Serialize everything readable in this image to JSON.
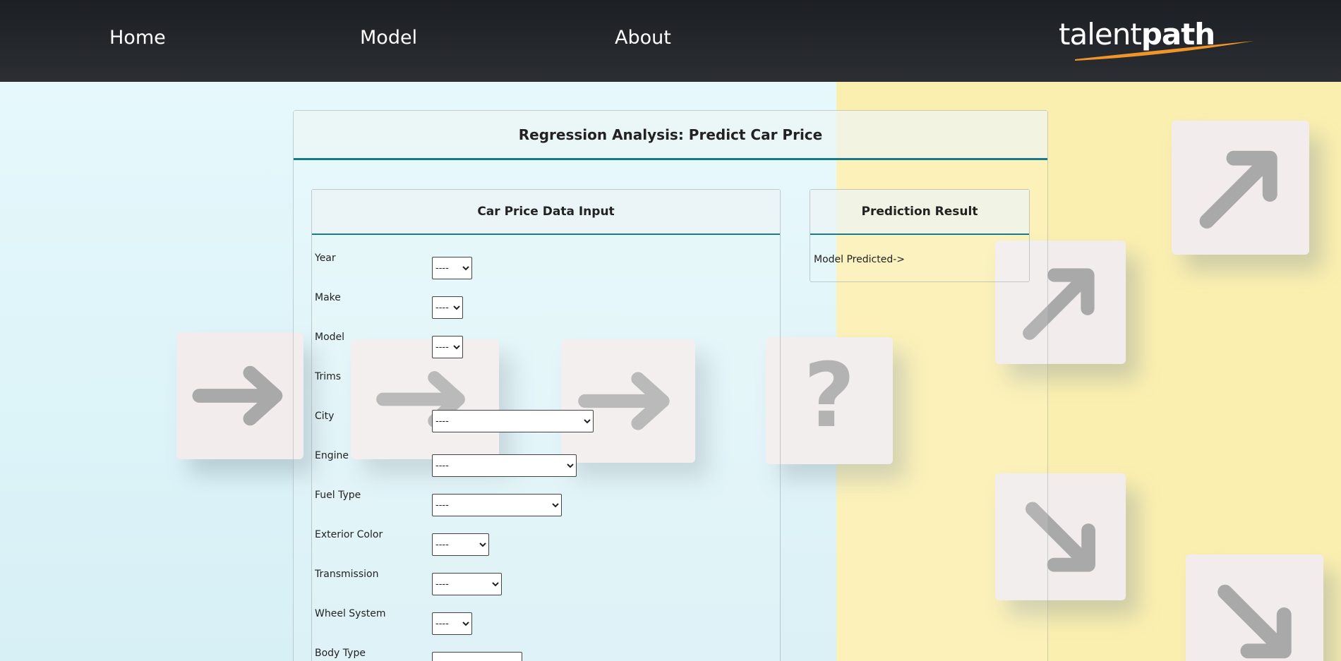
{
  "nav": {
    "links": [
      "Home",
      "Model",
      "About"
    ],
    "logo_text_light": "talent",
    "logo_text_bold": "path"
  },
  "panel": {
    "title": "Regression Analysis: Predict Car Price"
  },
  "input_card": {
    "title": "Car Price Data Input",
    "fields": [
      {
        "label": "Year",
        "value": "----"
      },
      {
        "label": "Make",
        "value": "----"
      },
      {
        "label": "Model",
        "value": "----"
      },
      {
        "label": "Trims",
        "value": ""
      },
      {
        "label": "City",
        "value": "----"
      },
      {
        "label": "Engine",
        "value": "----"
      },
      {
        "label": "Fuel Type",
        "value": "----"
      },
      {
        "label": "Exterior Color",
        "value": "----"
      },
      {
        "label": "Transmission",
        "value": "----"
      },
      {
        "label": "Wheel System",
        "value": "----"
      },
      {
        "label": "Body Type",
        "value": "----"
      }
    ]
  },
  "result_card": {
    "title": "Prediction Result",
    "text": "Model Predicted->"
  },
  "background": {
    "block_icons": [
      "arrow-right-icon",
      "arrow-right-icon",
      "arrow-right-icon",
      "question-mark-icon",
      "arrow-up-right-icon",
      "arrow-up-right-icon",
      "arrow-down-right-icon",
      "arrow-down-right-icon"
    ],
    "left_color": "#e3f7fb",
    "right_color": "#fbefb0"
  },
  "colors": {
    "nav_bg": "#1c1f23",
    "accent": "#147a8c",
    "logo_swoosh": "#f0952a"
  }
}
